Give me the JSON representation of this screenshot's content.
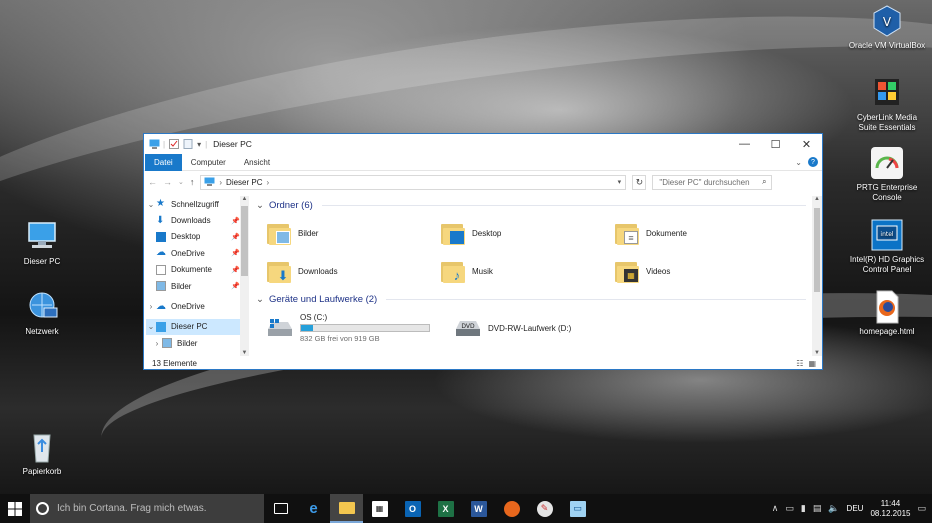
{
  "desktop": {
    "icons_left": [
      {
        "label": "Dieser PC",
        "icon": "computer-icon"
      },
      {
        "label": "Netzwerk",
        "icon": "network-icon"
      },
      {
        "label": "Papierkorb",
        "icon": "recycle-bin-icon"
      }
    ],
    "icons_right": [
      {
        "label": "Oracle VM VirtualBox",
        "icon": "virtualbox-icon"
      },
      {
        "label": "CyberLink Media Suite Essentials",
        "icon": "cyberlink-icon"
      },
      {
        "label": "PRTG Enterprise Console",
        "icon": "prtg-gauge-icon"
      },
      {
        "label": "Intel(R) HD Graphics Control Panel",
        "icon": "intel-graphics-icon"
      },
      {
        "label": "homepage.html",
        "icon": "firefox-document-icon"
      }
    ]
  },
  "explorer": {
    "title": "Dieser PC",
    "ribbon_tabs": [
      "Datei",
      "Computer",
      "Ansicht"
    ],
    "address": {
      "path_item": "Dieser PC"
    },
    "search": {
      "placeholder": "\"Dieser PC\" durchsuchen"
    },
    "nav": {
      "quick_access": "Schnellzugriff",
      "items": [
        "Downloads",
        "Desktop",
        "OneDrive",
        "Dokumente",
        "Bilder"
      ],
      "onedrive": "OneDrive",
      "this_pc": "Dieser PC",
      "this_pc_child": "Bilder"
    },
    "folders_heading": "Ordner (6)",
    "folders": [
      {
        "name": "Bilder",
        "icon": "pictures-folder-icon"
      },
      {
        "name": "Desktop",
        "icon": "desktop-folder-icon"
      },
      {
        "name": "Dokumente",
        "icon": "documents-folder-icon"
      },
      {
        "name": "Downloads",
        "icon": "downloads-folder-icon"
      },
      {
        "name": "Musik",
        "icon": "music-folder-icon"
      },
      {
        "name": "Videos",
        "icon": "videos-folder-icon"
      }
    ],
    "drives_heading": "Geräte und Laufwerke (2)",
    "drives": [
      {
        "name": "OS (C:)",
        "free_text": "832 GB frei von 919 GB",
        "used_fraction": 0.095
      },
      {
        "name": "DVD-RW-Laufwerk (D:)"
      }
    ],
    "status": "13 Elemente"
  },
  "taskbar": {
    "cortana_placeholder": "Ich bin Cortana. Frag mich etwas.",
    "apps": [
      "task-view-icon",
      "edge-icon",
      "file-explorer-icon",
      "store-icon",
      "outlook-icon",
      "excel-icon",
      "word-icon",
      "firefox-icon",
      "paint-icon",
      "remote-desktop-icon"
    ],
    "language": "DEU",
    "time": "11:44",
    "date": "08.12.2015"
  },
  "colors": {
    "accent": "#1979ca",
    "selection": "#cce8ff",
    "group_heading": "#1e3287"
  }
}
